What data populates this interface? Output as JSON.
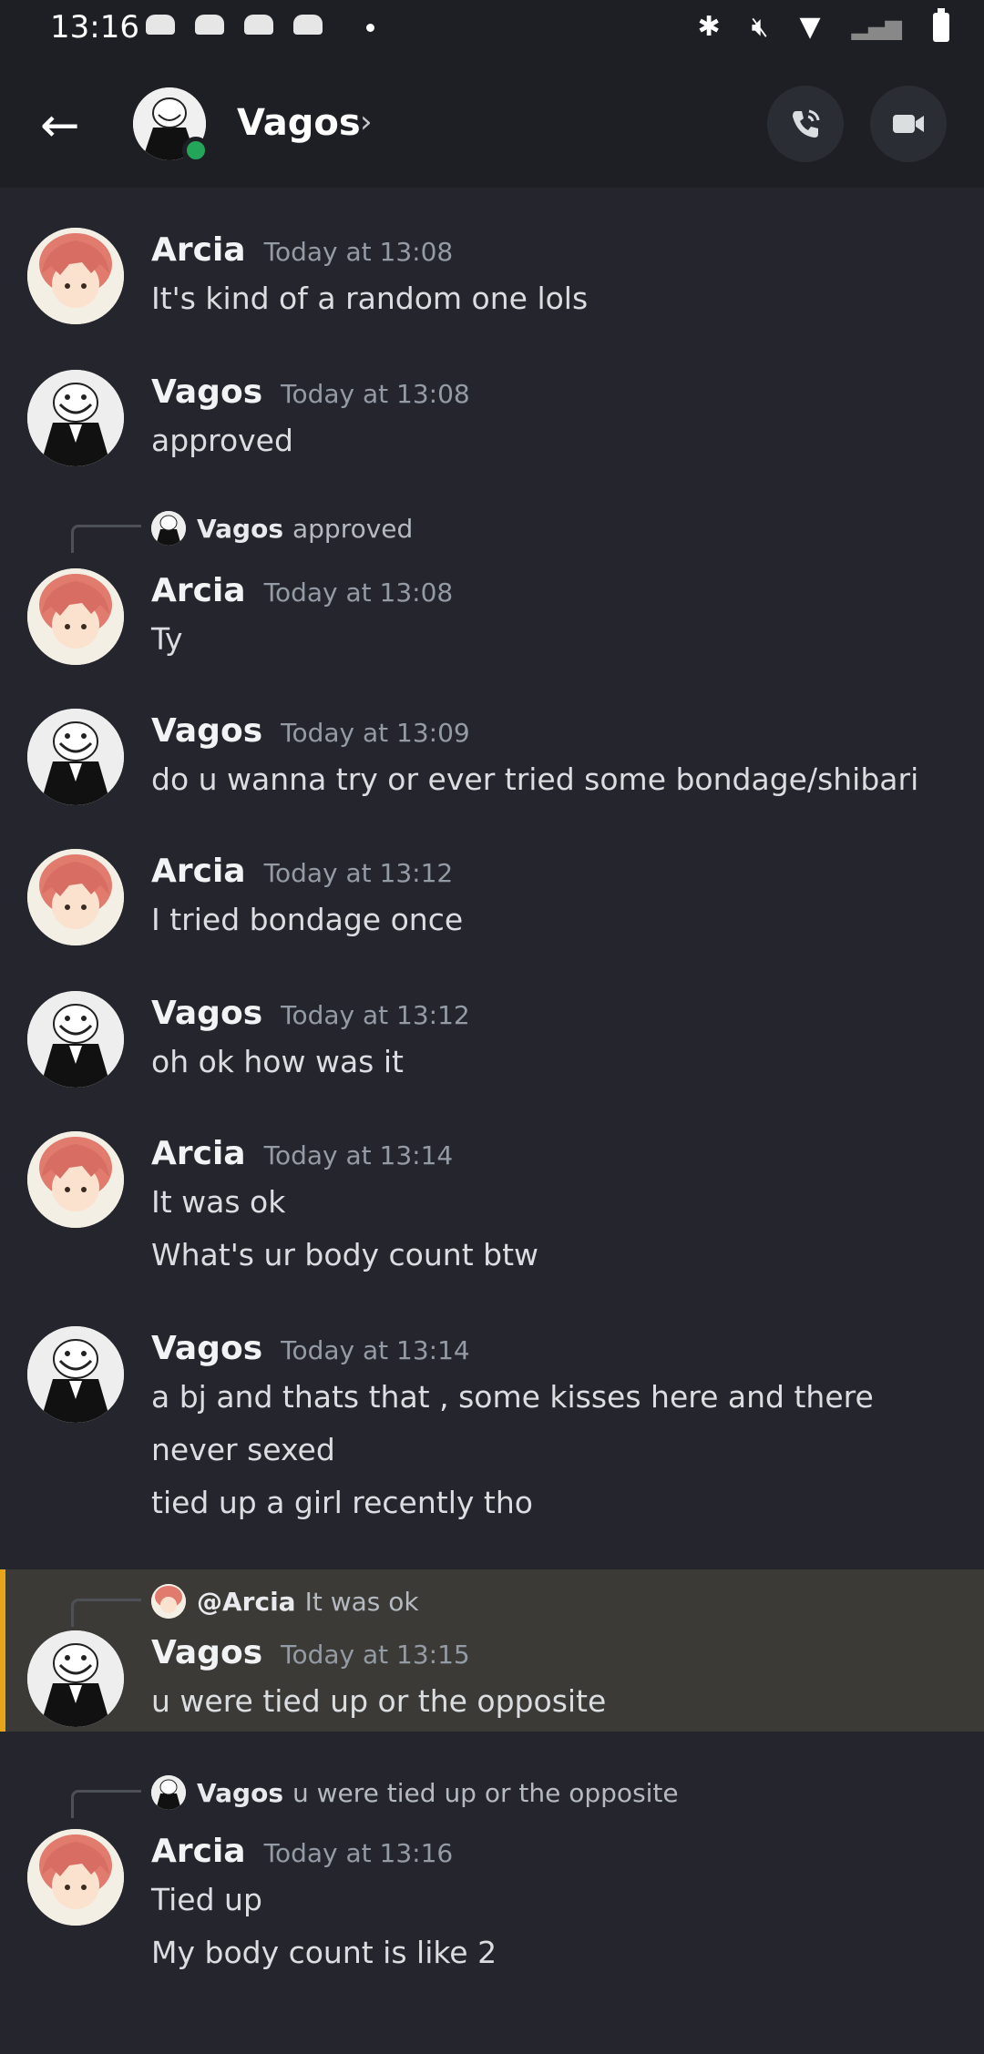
{
  "status_bar": {
    "time": "13:16"
  },
  "header": {
    "back_icon": "arrow-left-icon",
    "name": "Vagos",
    "chevron": "›",
    "online": true,
    "call_icon": "phone-call-icon",
    "video_icon": "video-camera-icon"
  },
  "messages": [
    {
      "author": "Arcia",
      "timestamp": "Today at 13:08",
      "lines": [
        "It's kind of a random one lols"
      ]
    },
    {
      "author": "Vagos",
      "timestamp": "Today at 13:08",
      "lines": [
        "approved"
      ]
    },
    {
      "reply": {
        "name": "Vagos",
        "text": "approved"
      },
      "author": "Arcia",
      "timestamp": "Today at 13:08",
      "lines": [
        "Ty"
      ]
    },
    {
      "author": "Vagos",
      "timestamp": "Today at 13:09",
      "lines": [
        "do u wanna try or ever tried some bondage/shibari"
      ]
    },
    {
      "author": "Arcia",
      "timestamp": "Today at 13:12",
      "lines": [
        "I tried bondage once"
      ]
    },
    {
      "author": "Vagos",
      "timestamp": "Today at 13:12",
      "lines": [
        "oh ok how was it"
      ]
    },
    {
      "author": "Arcia",
      "timestamp": "Today at 13:14",
      "lines": [
        "It was ok",
        "What's ur body count btw"
      ]
    },
    {
      "author": "Vagos",
      "timestamp": "Today at 13:14",
      "lines": [
        "a bj and thats that , some kisses here and there",
        "never sexed",
        "tied up a girl recently tho"
      ]
    },
    {
      "reply": {
        "name": "@Arcia",
        "text": "It was ok"
      },
      "author": "Vagos",
      "timestamp": "Today at 13:15",
      "lines": [
        "u were tied up or the opposite"
      ],
      "highlighted": true
    },
    {
      "reply": {
        "name": "Vagos",
        "text": "u were tied up or the opposite"
      },
      "author": "Arcia",
      "timestamp": "Today at 13:16",
      "lines": [
        "Tied up",
        "My body count is like 2"
      ]
    }
  ],
  "colors": {
    "background": "#24252d",
    "header": "#1e1f25",
    "online": "#23a55a",
    "mention_bar": "#e7a61a",
    "mention_bg": "#3b3a37"
  }
}
